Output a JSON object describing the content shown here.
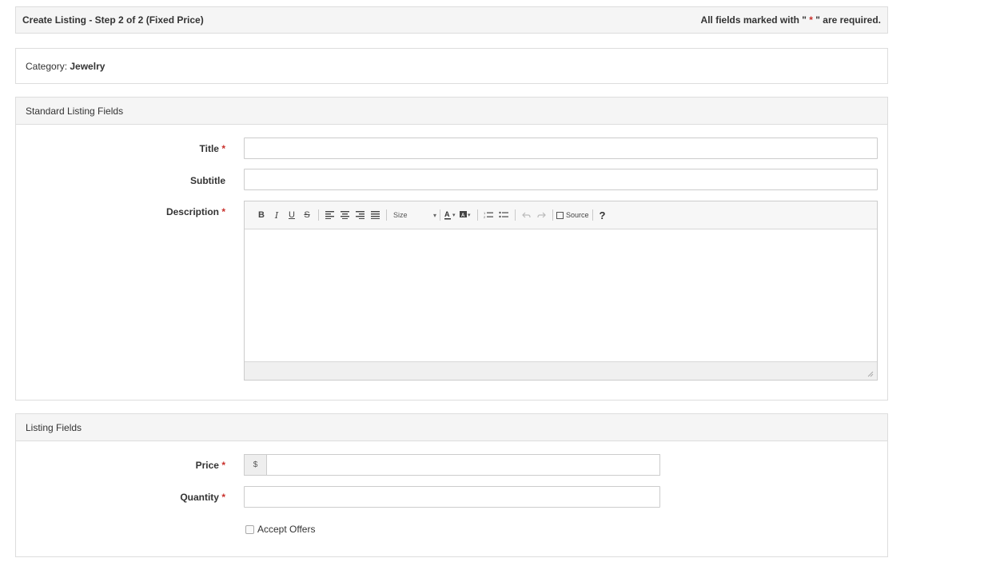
{
  "header": {
    "title": "Create Listing - Step 2 of 2 (Fixed Price)",
    "required_note_prefix": "All fields marked with \"",
    "required_note_star": " * ",
    "required_note_suffix": "\" are required."
  },
  "category": {
    "label": "Category:",
    "value": "Jewelry"
  },
  "standard_fields": {
    "heading": "Standard Listing Fields",
    "title_label": "Title",
    "subtitle_label": "Subtitle",
    "description_label": "Description",
    "required_star": "*",
    "editor": {
      "bold": "B",
      "italic": "I",
      "underline": "U",
      "strike": "S",
      "size_label": "Size",
      "source_label": "Source",
      "help": "?"
    }
  },
  "listing_fields": {
    "heading": "Listing Fields",
    "price_label": "Price",
    "currency_symbol": "$",
    "quantity_label": "Quantity",
    "accept_offers_label": "Accept Offers",
    "required_star": "*"
  },
  "colors": {
    "required_star": "#c9302c",
    "panel_heading_bg": "#f5f5f5",
    "border": "#dddddd"
  }
}
